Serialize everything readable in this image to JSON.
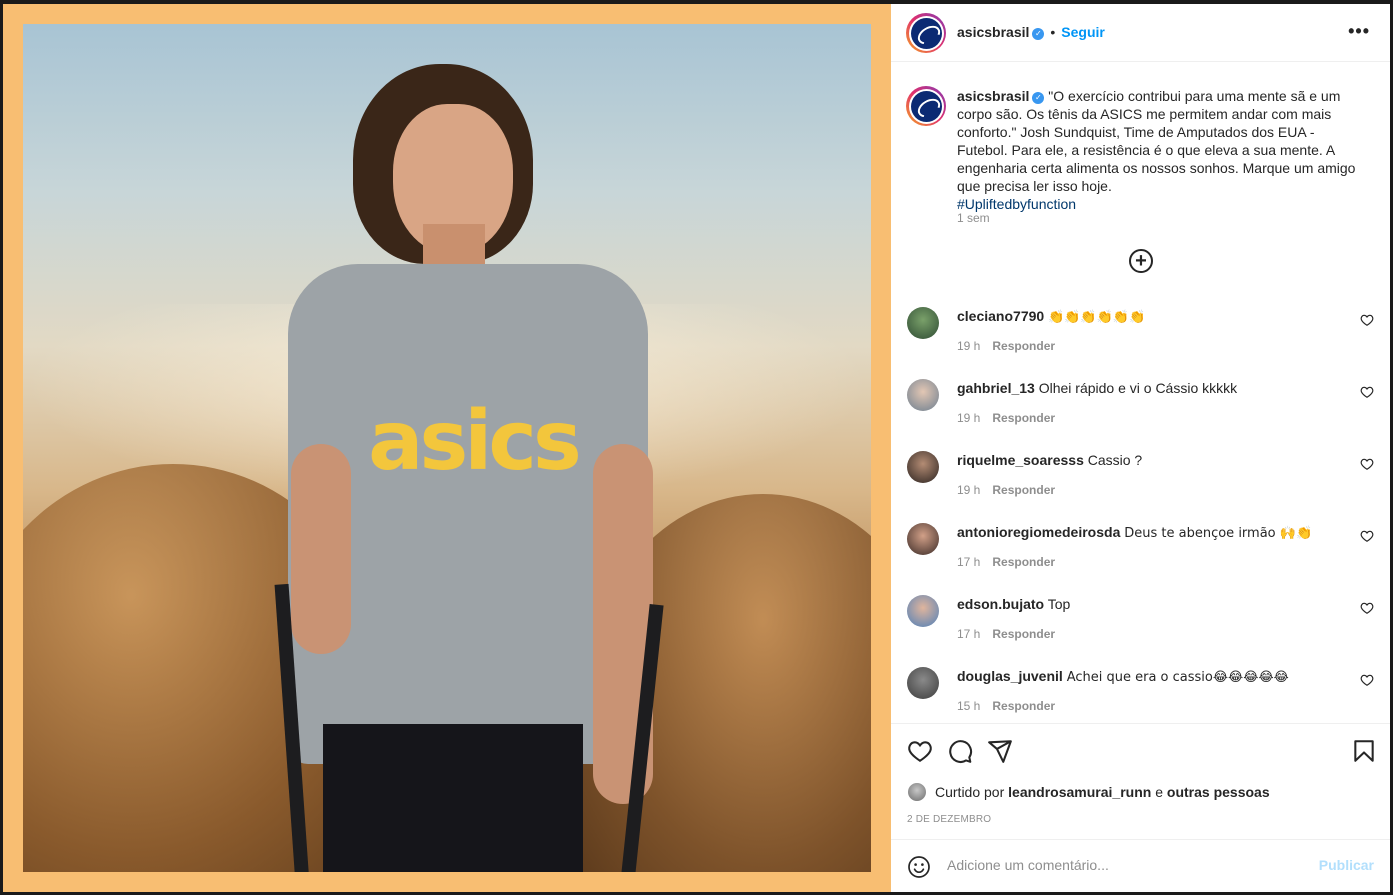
{
  "post": {
    "author": "asicsbrasil",
    "follow_label": "Seguir",
    "dot": "•",
    "more_label": "•••",
    "caption_text": "\"O exercício contribui para uma mente sã e um corpo são. Os tênis da ASICS me permitem andar com mais conforto.\" Josh Sundquist, Time de Amputados dos EUA - Futebol. Para ele, a resistência é o que eleva a sua mente. A engenharia certa alimenta os nossos sonhos. Marque um amigo que precisa ler isso hoje.",
    "hashtag": "#Upliftedbyfunction",
    "caption_time": "1 sem",
    "load_more_label": "+",
    "image_logo_text": "asics"
  },
  "comments": [
    {
      "user": "cleciano7790",
      "text": "👏👏👏👏👏👏",
      "time": "19 h",
      "reply": "Responder"
    },
    {
      "user": "gahbriel_13",
      "text": "Olhei rápido e vi o Cássio kkkkk",
      "time": "19 h",
      "reply": "Responder"
    },
    {
      "user": "riquelme_soaresss",
      "text": "Cassio ?",
      "time": "19 h",
      "reply": "Responder"
    },
    {
      "user": "antonioregiomedeirosda",
      "text": "Deus te abençoe irmão 🙌👏",
      "time": "17 h",
      "reply": "Responder"
    },
    {
      "user": "edson.bujato",
      "text": "Top",
      "time": "17 h",
      "reply": "Responder"
    },
    {
      "user": "douglas_juvenil",
      "text": "Achei que era o cassio😂😂😂😂😂",
      "time": "15 h",
      "reply": "Responder"
    }
  ],
  "footer": {
    "liked_prefix": "Curtido por",
    "liked_user": "leandrosamurai_runn",
    "liked_and": "e",
    "liked_others": "outras pessoas",
    "date": "2 DE DEZEMBRO",
    "comment_placeholder": "Adicione um comentário...",
    "publish_label": "Publicar"
  },
  "colors": {
    "frame": "#f8be72",
    "link": "#0095f6",
    "hashtag": "#00376b",
    "muted": "#8e8e8e",
    "publish_disabled": "#b2dffc"
  }
}
